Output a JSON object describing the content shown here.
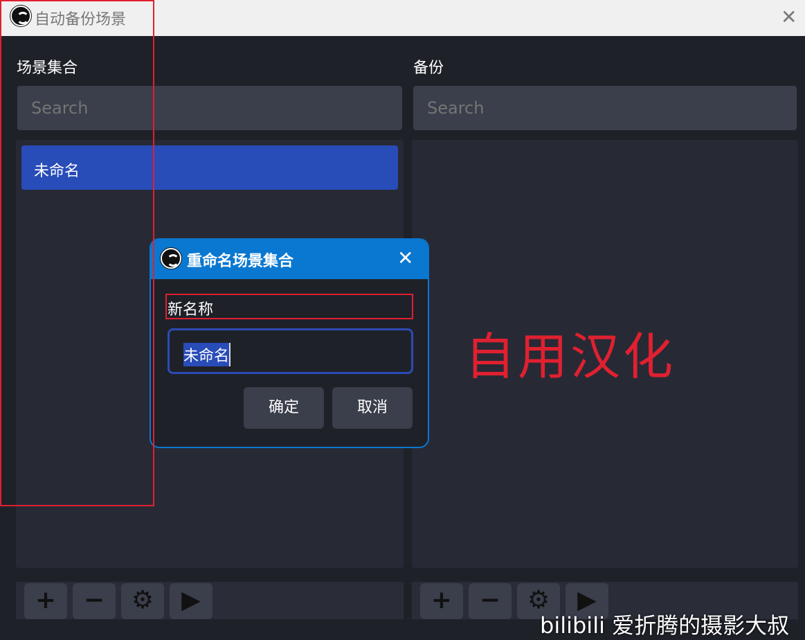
{
  "window": {
    "title": "自动备份场景",
    "close": "✕"
  },
  "left": {
    "heading": "场景集合",
    "search_placeholder": "Search",
    "items": [
      "未命名"
    ]
  },
  "right": {
    "heading": "备份",
    "search_placeholder": "Search"
  },
  "toolbar": {
    "add": "+",
    "remove": "−",
    "settings": "⚙",
    "play": "▶"
  },
  "dialog": {
    "title": "重命名场景集合",
    "close": "✕",
    "label": "新名称",
    "value": "未命名",
    "ok": "确定",
    "cancel": "取消"
  },
  "annotation": "自用汉化",
  "watermark": "bilibili 爱折腾的摄影大叔"
}
